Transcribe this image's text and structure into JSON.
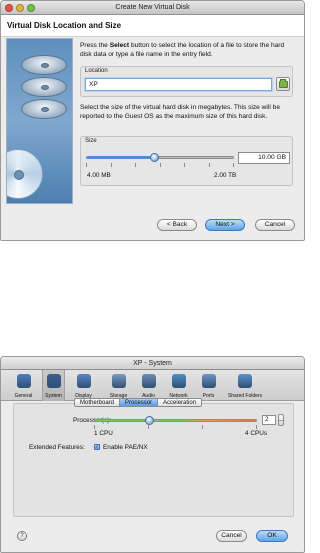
{
  "dialog1": {
    "title": "Create New Virtual Disk",
    "heading": "Virtual Disk Location and Size",
    "location_desc_part1": "Press the ",
    "location_desc_bold": "Select",
    "location_desc_part2": " button to select the location of a file to store the hard disk data or type a file name in the entry field.",
    "location_label": "Location",
    "location_value": "XP",
    "size_desc": "Select the size of the virtual hard disk in megabytes. This size will be reported to the Guest OS as the maximum size of this hard disk.",
    "size_label": "Size",
    "size_value": "10.00 GB",
    "size_slider_fraction": 0.45,
    "size_min": "4.00 MB",
    "size_max": "2.00 TB",
    "back_button": "< Back",
    "next_button": "Next >",
    "cancel_button": "Cancel"
  },
  "dialog2": {
    "title": "XP - System",
    "toolbar": [
      {
        "label": "General",
        "icon": "general-icon",
        "color": "#4f7fc1"
      },
      {
        "label": "System",
        "icon": "system-icon",
        "color": "#3b5f91"
      },
      {
        "label": "Display",
        "icon": "display-icon",
        "color": "#5a86c2"
      },
      {
        "label": "Storage",
        "icon": "storage-icon",
        "color": "#7f9cbb"
      },
      {
        "label": "Audio",
        "icon": "audio-icon",
        "color": "#6d8fb5"
      },
      {
        "label": "Network",
        "icon": "network-icon",
        "color": "#4d8fc4"
      },
      {
        "label": "Ports",
        "icon": "ports-icon",
        "color": "#6b97c8"
      },
      {
        "label": "Shared Folders",
        "icon": "shared-folders-icon",
        "color": "#5a92d1"
      }
    ],
    "selected_tool": 1,
    "tabs": [
      "Motherboard",
      "Processor",
      "Acceleration"
    ],
    "active_tab": 1,
    "processors_label": "Processor(s):",
    "processors_value": "2",
    "processors_fraction": 0.33,
    "processors_min": "1 CPU",
    "processors_max": "4 CPUs",
    "extended_features_label": "Extended Features:",
    "pae_label": "Enable PAE/NX",
    "pae_checked": true,
    "help_glyph": "?",
    "cancel_button": "Cancel",
    "ok_button": "OK"
  }
}
